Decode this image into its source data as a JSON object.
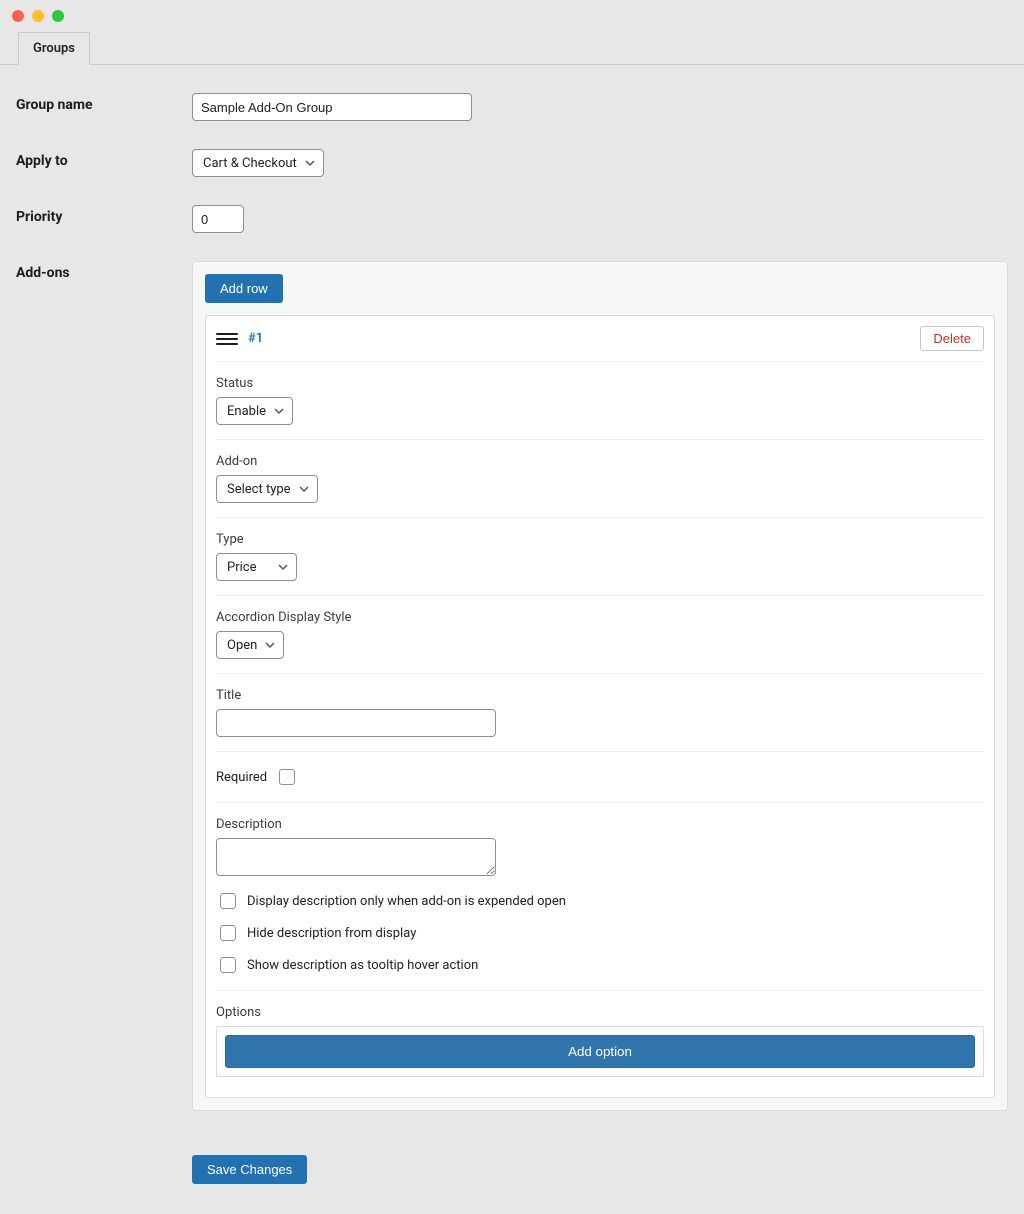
{
  "tab": {
    "label": "Groups"
  },
  "labels": {
    "group_name": "Group name",
    "apply_to": "Apply to",
    "priority": "Priority",
    "addons": "Add-ons"
  },
  "group_name_value": "Sample Add-On Group",
  "apply_to_value": "Cart & Checkout",
  "priority_value": "0",
  "buttons": {
    "add_row": "Add row",
    "delete": "Delete",
    "add_option": "Add option",
    "save": "Save Changes"
  },
  "row": {
    "id_label": "#1",
    "status_label": "Status",
    "status_value": "Enable",
    "addon_label": "Add-on",
    "addon_value": "Select type",
    "type_label": "Type",
    "type_value": "Price",
    "accordion_label": "Accordion Display Style",
    "accordion_value": "Open",
    "title_label": "Title",
    "title_value": "",
    "required_label": "Required",
    "description_label": "Description",
    "description_value": "",
    "desc_opt1": "Display description only when add-on is expended open",
    "desc_opt2": "Hide description from display",
    "desc_opt3": "Show description as tooltip hover action",
    "options_label": "Options"
  }
}
